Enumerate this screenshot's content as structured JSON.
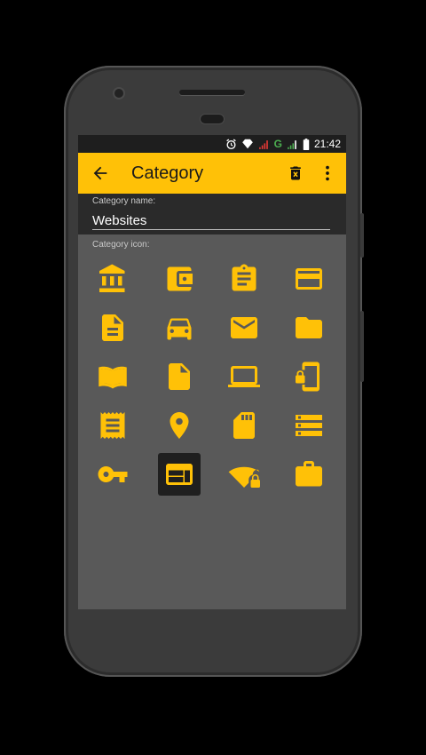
{
  "status_bar": {
    "time": "21:42",
    "network": "G"
  },
  "app_bar": {
    "title": "Category"
  },
  "form": {
    "name_label": "Category name:",
    "name_value": "Websites",
    "icon_label": "Category icon:"
  },
  "icons": [
    {
      "name": "bank-icon"
    },
    {
      "name": "wallet-icon"
    },
    {
      "name": "clipboard-icon"
    },
    {
      "name": "credit-card-icon"
    },
    {
      "name": "document-icon"
    },
    {
      "name": "car-icon"
    },
    {
      "name": "email-icon"
    },
    {
      "name": "folder-icon"
    },
    {
      "name": "book-icon"
    },
    {
      "name": "file-icon"
    },
    {
      "name": "laptop-icon"
    },
    {
      "name": "phone-lock-icon"
    },
    {
      "name": "receipt-icon"
    },
    {
      "name": "location-pin-icon"
    },
    {
      "name": "sd-card-icon"
    },
    {
      "name": "server-icon"
    },
    {
      "name": "key-icon"
    },
    {
      "name": "web-icon"
    },
    {
      "name": "wifi-lock-icon"
    },
    {
      "name": "briefcase-icon"
    }
  ],
  "selected_icon": "web-icon",
  "colors": {
    "accent": "#ffc107",
    "selected_bg": "#1f1f1f",
    "screen_bg": "#595959"
  }
}
